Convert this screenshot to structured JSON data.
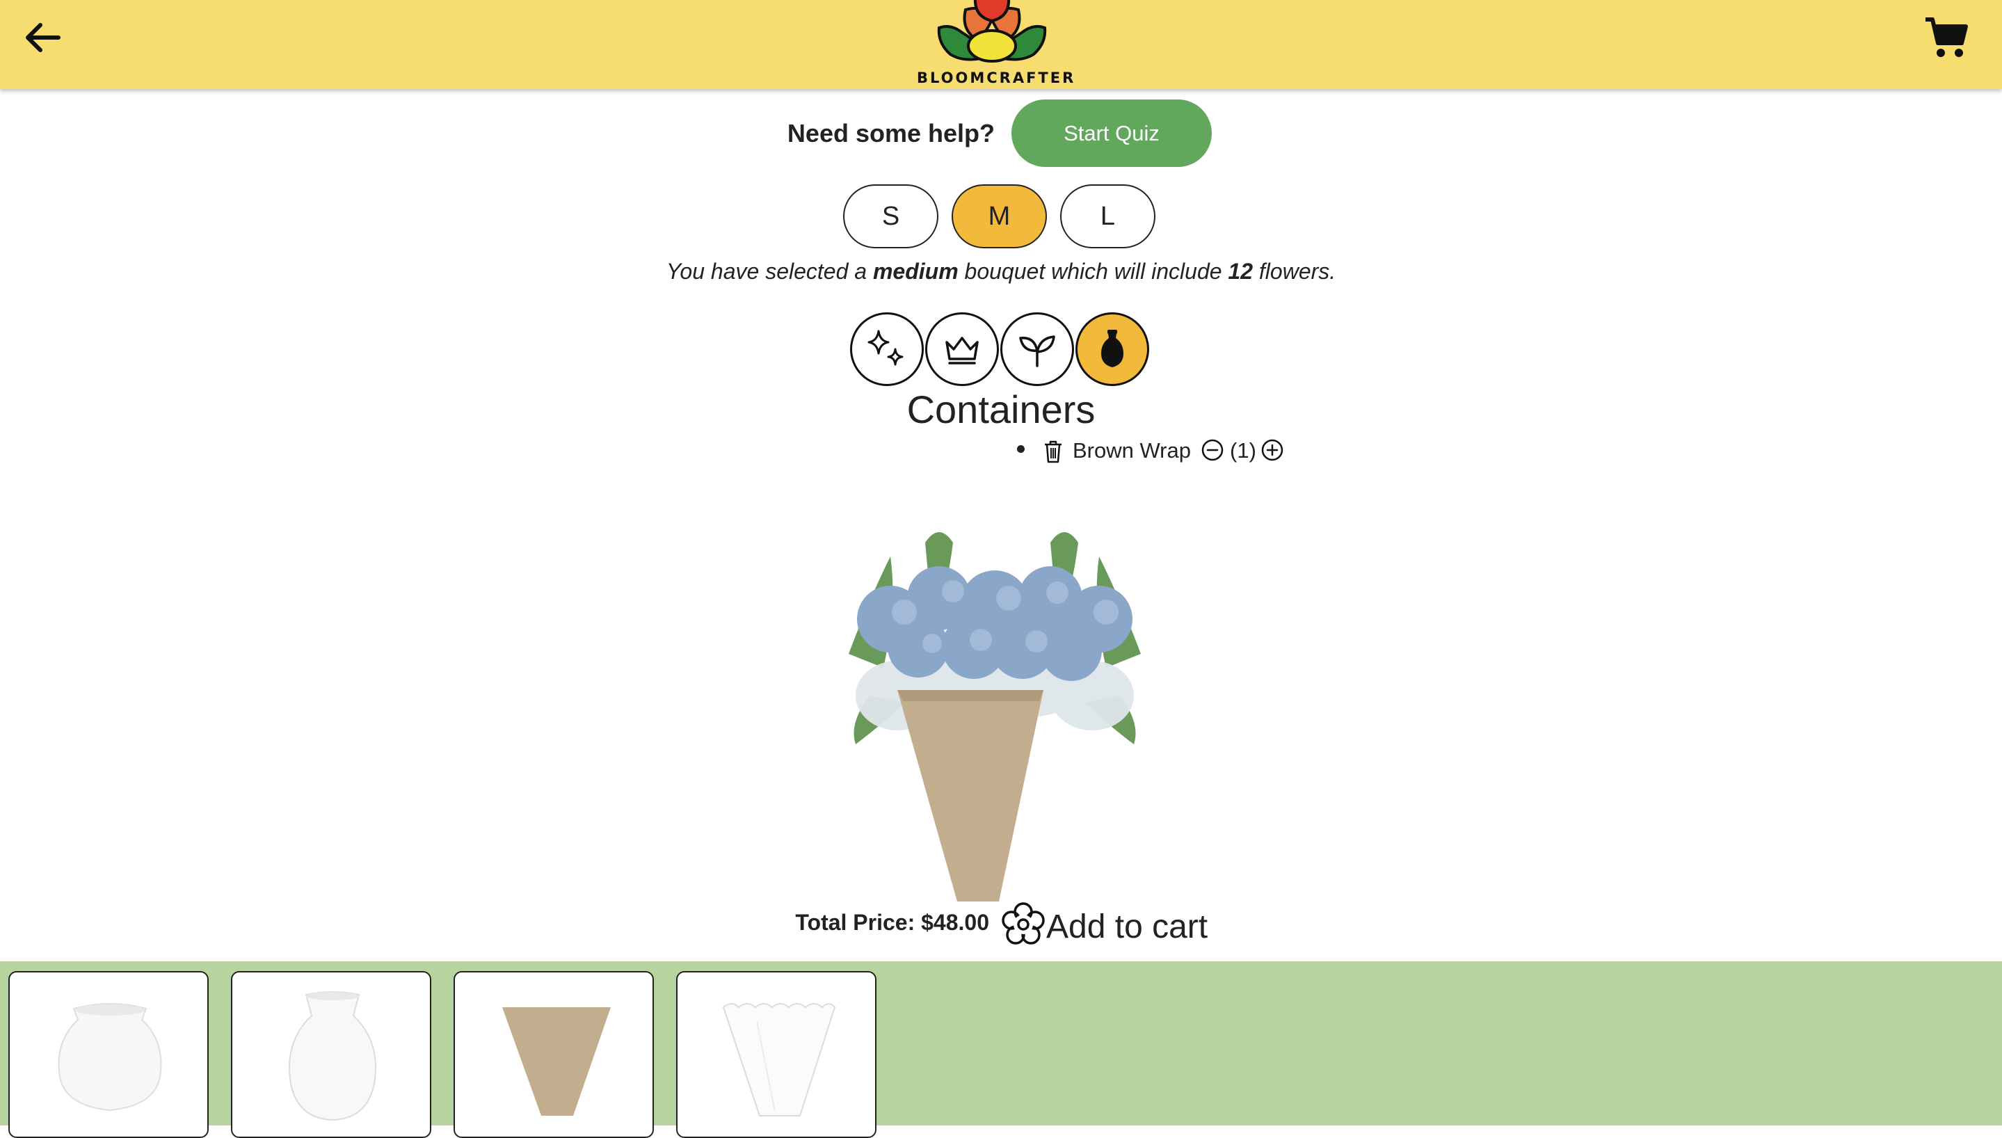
{
  "header": {
    "back_icon": "arrow-left-icon",
    "logo_text": "BLOOMCRAFTER",
    "cart_icon": "shopping-cart-icon",
    "background": "#f7dc6f"
  },
  "help": {
    "prompt": "Need some help?",
    "quiz_label": "Start Quiz",
    "quiz_color": "#62a85c"
  },
  "sizes": {
    "options": [
      "S",
      "M",
      "L"
    ],
    "selected": "M",
    "selected_color": "#f2b93b"
  },
  "size_message": {
    "prefix": "You have selected a",
    "size_word": "medium",
    "middle": "bouquet which will include",
    "count": "12",
    "suffix": "flowers."
  },
  "categories": {
    "icons": [
      "sparkles-icon",
      "crown-icon",
      "leaf-sprout-icon",
      "vase-icon"
    ],
    "selected_index": 3
  },
  "section": {
    "title": "Containers",
    "items": [
      {
        "name": "Brown Wrap",
        "quantity": "(1)"
      }
    ]
  },
  "summary": {
    "price_label": "Total Price: $48.00",
    "add_to_cart_label": "Add to cart",
    "add_to_cart_icon": "flower-icon"
  },
  "tray": {
    "background": "#b8d49e",
    "options": [
      "round-white-vase",
      "tall-white-vase",
      "brown-wrap",
      "white-wrap"
    ]
  }
}
